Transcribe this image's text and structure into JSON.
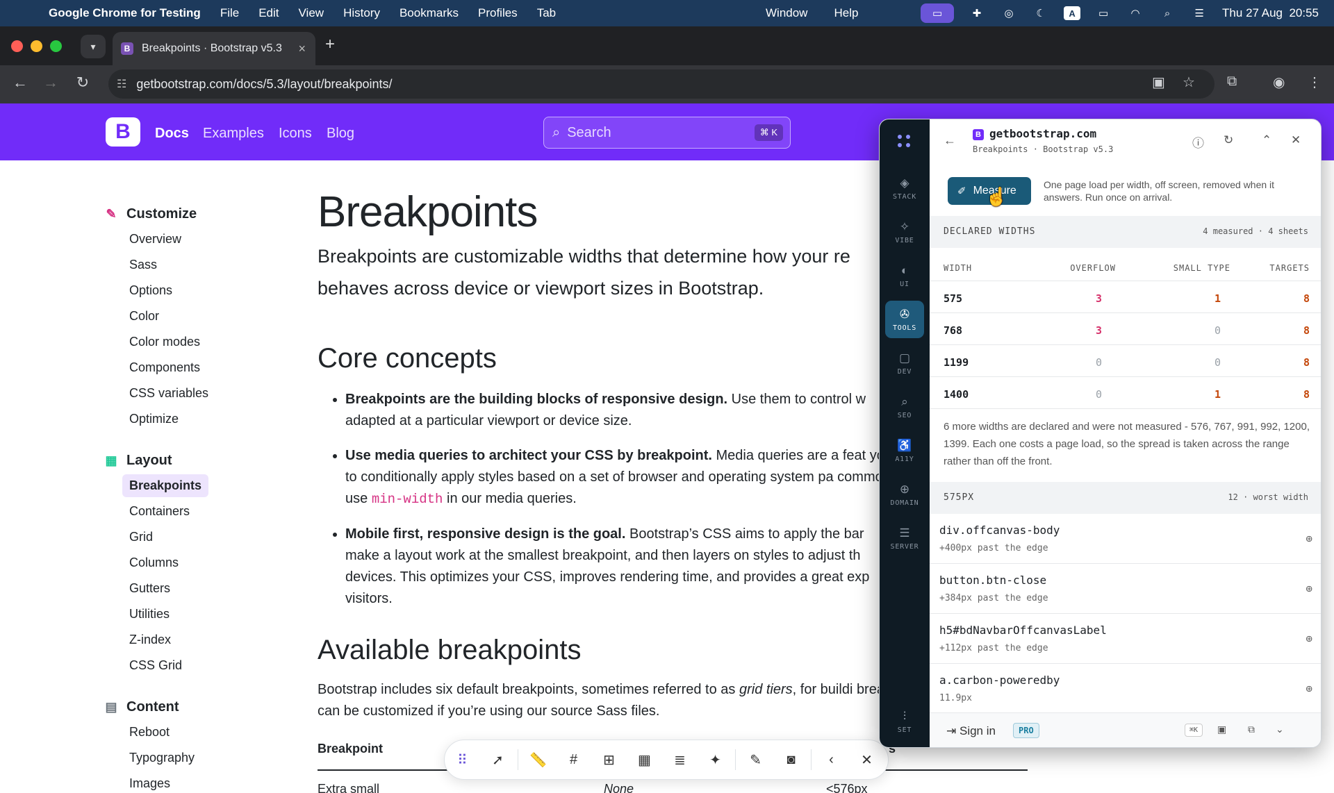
{
  "menubar": {
    "app_name": "Google Chrome for Testing",
    "items": [
      "File",
      "Edit",
      "View",
      "History",
      "Bookmarks",
      "Profiles",
      "Tab"
    ],
    "items_right": [
      "Window",
      "Help"
    ],
    "clock": "Thu 27 Aug  20:55"
  },
  "browser": {
    "tab_title": "Breakpoints · Bootstrap v5.3",
    "url": "getbootstrap.com/docs/5.3/layout/breakpoints/"
  },
  "bsnav": {
    "links": [
      "Docs",
      "Examples",
      "Icons",
      "Blog"
    ],
    "search_placeholder": "Search",
    "search_shortcut": "⌘ K"
  },
  "sidebar": {
    "groups": [
      {
        "title": "Customize",
        "icon": "palette-icon",
        "items": [
          "Overview",
          "Sass",
          "Options",
          "Color",
          "Color modes",
          "Components",
          "CSS variables",
          "Optimize"
        ]
      },
      {
        "title": "Layout",
        "icon": "grid-icon",
        "items": [
          "Breakpoints",
          "Containers",
          "Grid",
          "Columns",
          "Gutters",
          "Utilities",
          "Z-index",
          "CSS Grid"
        ]
      },
      {
        "title": "Content",
        "icon": "document-icon",
        "items": [
          "Reboot",
          "Typography",
          "Images"
        ]
      }
    ]
  },
  "main": {
    "title": "Breakpoints",
    "lead": "Breakpoints are customizable widths that determine how your re behaves across device or viewport sizes in Bootstrap.",
    "h_core": "Core concepts",
    "b1_bold": "Breakpoints are the building blocks of responsive design.",
    "b1_text": " Use them to control w adapted at a particular viewport or device size.",
    "b2_bold": "Use media queries to architect your CSS by breakpoint.",
    "b2_text": " Media queries are a feat you to conditionally apply styles based on a set of browser and operating system pa commonly use ",
    "b2_code": "min-width",
    "b2_tail": " in our media queries.",
    "b3_bold": "Mobile first, responsive design is the goal.",
    "b3_text": " Bootstrap’s CSS aims to apply the bar make a layout work at the smallest breakpoint, and then layers on styles to adjust th devices. This optimizes your CSS, improves rendering time, and provides a great exp visitors.",
    "h_avail": "Available breakpoints",
    "avail_a": "Bootstrap includes six default breakpoints, sometimes referred to as ",
    "avail_em": "grid tiers",
    "avail_b": ", for buildi breakpoints can be customized if you’re using our source Sass files.",
    "table_head": "Breakpoint",
    "table_head_cut": "s",
    "row_name": "Extra small",
    "row_infix": "None",
    "row_dim": "<576px"
  },
  "panel": {
    "host": "getbootstrap.com",
    "subtitle": "Breakpoints · Bootstrap v5.3",
    "rail": [
      "STACK",
      "VIBE",
      "UI",
      "TOOLS",
      "DEV",
      "SEO",
      "A11Y",
      "DOMAIN",
      "SERVER",
      "SET"
    ],
    "measure_label": "Measure",
    "measure_note": "One page load per width, off screen, removed when it answers. Run once on arrival.",
    "declared_title": "DECLARED WIDTHS",
    "declared_meta": "4 measured · 4 sheets",
    "cols": [
      "WIDTH",
      "OVERFLOW",
      "SMALL TYPE",
      "TARGETS"
    ],
    "rows": [
      {
        "width": "575",
        "overflow": "3",
        "small": "1",
        "targets": "8"
      },
      {
        "width": "768",
        "overflow": "3",
        "small": "0",
        "targets": "8"
      },
      {
        "width": "1199",
        "overflow": "0",
        "small": "0",
        "targets": "8"
      },
      {
        "width": "1400",
        "overflow": "0",
        "small": "1",
        "targets": "8"
      }
    ],
    "note": "6 more widths are declared and were not measured - 576, 767, 991, 992, 1200, 1399. Each one costs a page load, so the spread is taken across the range rather than off the front.",
    "section2_title": "575PX",
    "section2_meta": "12 · worst width",
    "overflow_items": [
      {
        "selector": "div.offcanvas-body",
        "detail": "+400px past the edge"
      },
      {
        "selector": "button.btn-close",
        "detail": "+384px past the edge"
      },
      {
        "selector": "h5#bdNavbarOffcanvasLabel",
        "detail": "+112px past the edge"
      },
      {
        "selector": "a.carbon-poweredby",
        "detail": "11.9px"
      }
    ],
    "signin": "Sign in",
    "pro": "PRO",
    "shortcut": "⌘K"
  },
  "colors": {
    "bootstrap_purple": "#712cf9",
    "panel_accent": "#1a5a78",
    "rail_bg": "#0f1b24"
  }
}
